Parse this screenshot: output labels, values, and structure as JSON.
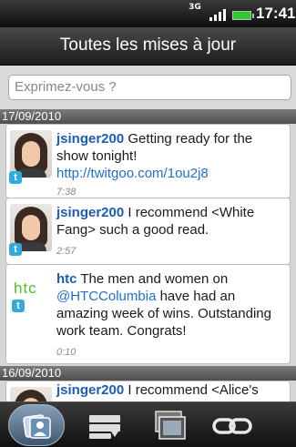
{
  "status_bar": {
    "network": "3G",
    "time": "17:41"
  },
  "header": {
    "title": "Toutes les mises à jour"
  },
  "compose": {
    "placeholder": "Exprimez-vous ?"
  },
  "feed": {
    "groups": [
      {
        "date": "17/09/2010",
        "posts": [
          {
            "user": "jsinger200",
            "text": " Getting ready for the show tonight! ",
            "link": "http://twitgoo.com/1ou2j8",
            "time": "7:38"
          },
          {
            "user": "jsinger200",
            "text": " I recommend <White Fang>  such a good read.",
            "time": "2:57"
          },
          {
            "user": "htc",
            "text_before": " The men and women on ",
            "mention": "@HTCColumbia",
            "text_after": " have had an amazing week of wins. Outstanding work team. Congrats!",
            "time": "0:10",
            "logo_text": "htc"
          }
        ]
      },
      {
        "date": "16/09/2010",
        "posts": [
          {
            "user": "jsinger200",
            "text": " I recommend <Alice's"
          }
        ]
      }
    ]
  },
  "bottom_tabs": [
    {
      "icon": "people-icon",
      "active": true
    },
    {
      "icon": "message-list-icon",
      "active": false
    },
    {
      "icon": "photo-album-icon",
      "active": false
    },
    {
      "icon": "link-icon",
      "active": false
    }
  ],
  "colors": {
    "username": "#1c5cb5",
    "link": "#1f6fcf",
    "battery": "#2ec92e",
    "htc_green": "#4fbf2a",
    "twitter_blue": "#33aadd"
  }
}
